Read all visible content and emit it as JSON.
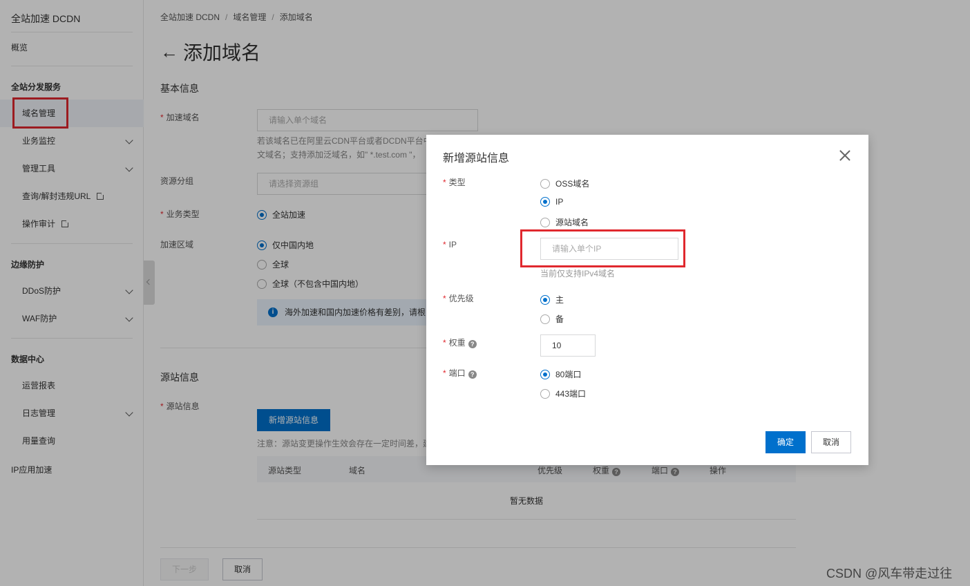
{
  "sidebar": {
    "title": "全站加速 DCDN",
    "overview": "概览",
    "groups": [
      {
        "label": "全站分发服务"
      },
      {
        "label": "边缘防护"
      },
      {
        "label": "数据中心"
      }
    ],
    "items": [
      {
        "label": "域名管理"
      },
      {
        "label": "业务监控"
      },
      {
        "label": "管理工具"
      },
      {
        "label": "查询/解封违规URL"
      },
      {
        "label": "操作审计"
      },
      {
        "label": "DDoS防护"
      },
      {
        "label": "WAF防护"
      },
      {
        "label": "运营报表"
      },
      {
        "label": "日志管理"
      },
      {
        "label": "用量查询"
      }
    ],
    "ip_accel": "IP应用加速"
  },
  "breadcrumb": [
    "全站加速 DCDN",
    "域名管理",
    "添加域名"
  ],
  "page": {
    "title": "添加域名",
    "basic_section": "基本信息",
    "domain_label": "加速域名",
    "domain_placeholder": "请输入单个域名",
    "domain_hint_1": "若该域名已在阿里云CDN平台或者DCDN平台中",
    "domain_hint_2": "文域名；支持添加泛域名，如\" *.test.com \"，",
    "group_label": "资源分组",
    "group_placeholder": "请选择资源组",
    "biz_label": "业务类型",
    "biz_option": "全站加速",
    "region_label": "加速区域",
    "region_options": [
      "仅中国内地",
      "全球",
      "全球（不包含中国内地）"
    ],
    "notice": "海外加速和国内加速价格有差别，请根",
    "origin_section": "源站信息",
    "origin_label": "源站信息",
    "add_origin_button": "新增源站信息",
    "origin_note": "注意：源站变更操作生效会存在一定时间差，建",
    "table_headers": [
      "源站类型",
      "域名",
      "优先级",
      "权重",
      "端口",
      "操作"
    ],
    "table_empty": "暂无数据",
    "next_button": "下一步",
    "cancel_button": "取消"
  },
  "dialog": {
    "title": "新增源站信息",
    "type_label": "类型",
    "type_options": [
      "OSS域名",
      "IP",
      "源站域名"
    ],
    "ip_label": "IP",
    "ip_placeholder": "请输入单个IP",
    "ip_hint": "当前仅支持IPv4域名",
    "priority_label": "优先级",
    "priority_options": [
      "主",
      "备"
    ],
    "weight_label": "权重",
    "weight_value": "10",
    "port_label": "端口",
    "port_options": [
      "80端口",
      "443端口"
    ],
    "ok_button": "确定",
    "cancel_button": "取消"
  },
  "watermark": "CSDN @风车带走过往",
  "colors": {
    "primary": "#0070cc",
    "highlight": "#e0282e"
  }
}
